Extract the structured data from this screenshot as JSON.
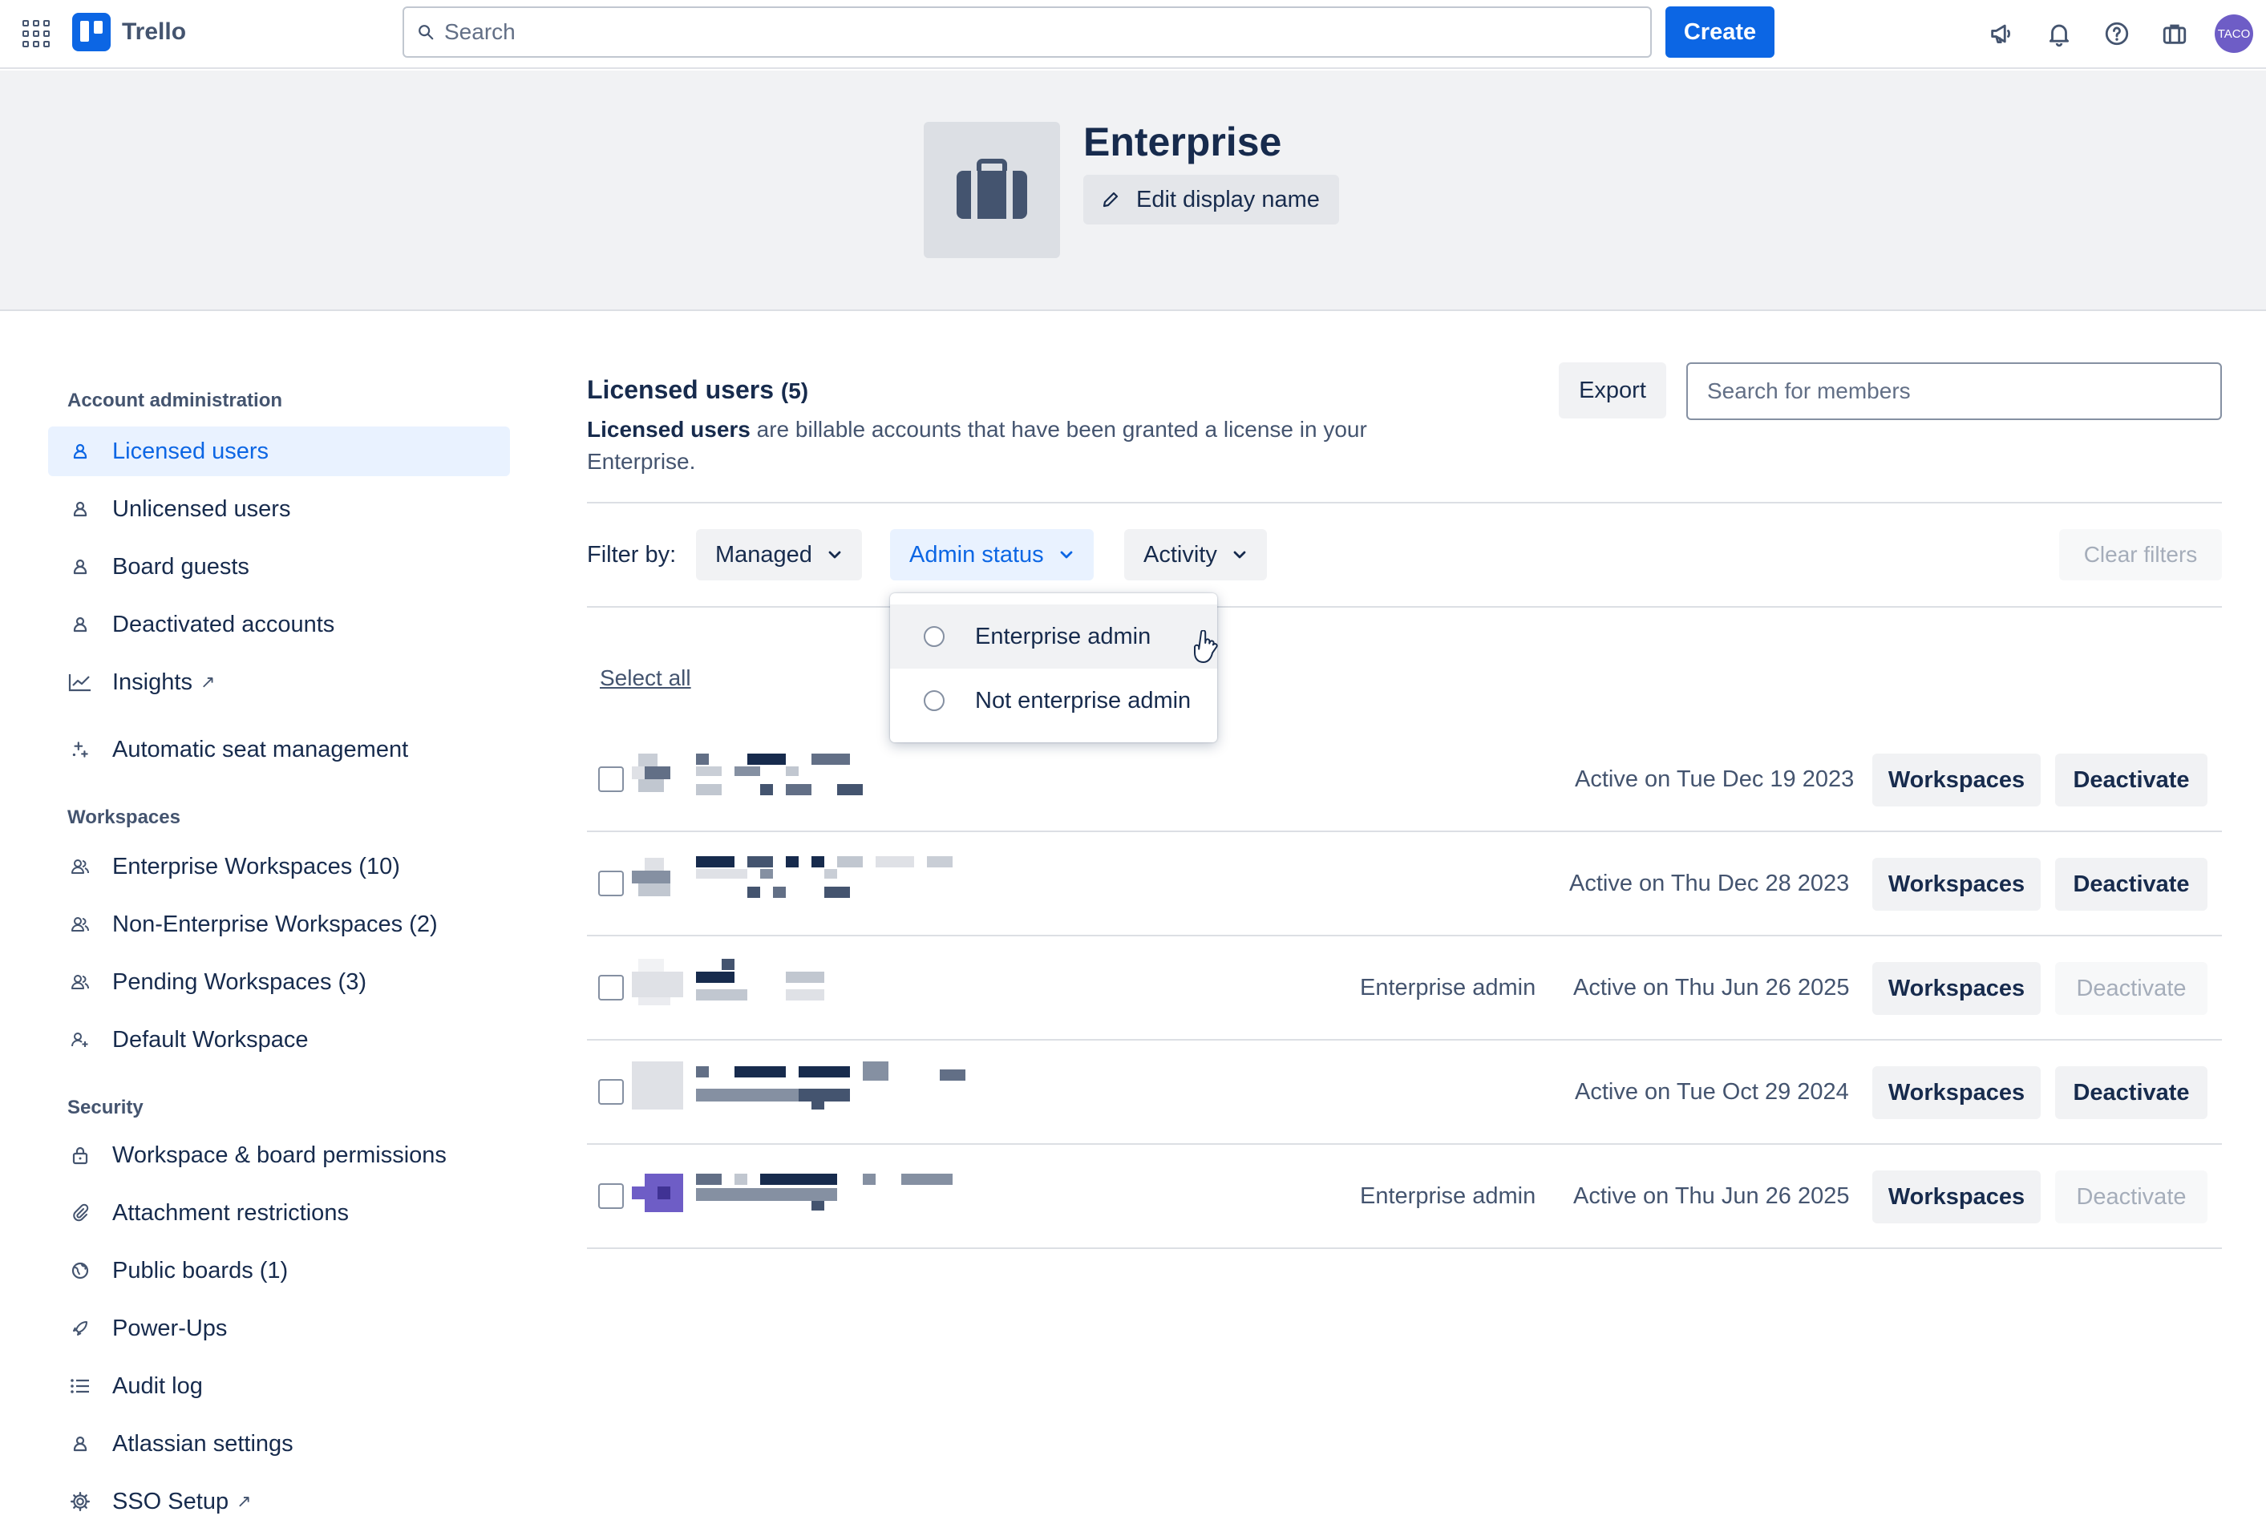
{
  "topbar": {
    "app_name": "Trello",
    "search_placeholder": "Search",
    "create_label": "Create",
    "avatar_text": "TACO"
  },
  "enterprise": {
    "name": "Enterprise",
    "edit_label": "Edit display name"
  },
  "sidebar": {
    "sections": [
      {
        "heading": "Account administration",
        "items": [
          {
            "label": "Licensed users",
            "icon": "person-icon",
            "active": true
          },
          {
            "label": "Unlicensed users",
            "icon": "person-icon"
          },
          {
            "label": "Board guests",
            "icon": "person-icon"
          },
          {
            "label": "Deactivated accounts",
            "icon": "person-icon"
          },
          {
            "label": "Insights",
            "icon": "chart-line-icon",
            "external": true
          },
          {
            "label": "Automatic seat management",
            "icon": "sparkle-icon"
          }
        ]
      },
      {
        "heading": "Workspaces",
        "items": [
          {
            "label": "Enterprise Workspaces (10)",
            "icon": "people-icon"
          },
          {
            "label": "Non-Enterprise Workspaces (2)",
            "icon": "people-icon"
          },
          {
            "label": "Pending Workspaces (3)",
            "icon": "people-icon"
          },
          {
            "label": "Default Workspace",
            "icon": "person-add-icon"
          }
        ]
      },
      {
        "heading": "Security",
        "items": [
          {
            "label": "Workspace & board permissions",
            "icon": "lock-icon"
          },
          {
            "label": "Attachment restrictions",
            "icon": "paperclip-icon"
          },
          {
            "label": "Public boards (1)",
            "icon": "globe-icon"
          },
          {
            "label": "Power-Ups",
            "icon": "rocket-icon"
          },
          {
            "label": "Audit log",
            "icon": "list-icon"
          },
          {
            "label": "Atlassian settings",
            "icon": "person-icon"
          },
          {
            "label": "SSO Setup",
            "icon": "gear-icon",
            "external": true
          }
        ]
      }
    ]
  },
  "main": {
    "title": "Licensed users",
    "count": "(5)",
    "desc_bold": "Licensed users",
    "desc_rest": " are billable accounts that have been granted a license in your Enterprise.",
    "export_label": "Export",
    "member_search_placeholder": "Search for members",
    "filter_label": "Filter by:",
    "filters": [
      "Managed",
      "Admin status",
      "Activity"
    ],
    "clear_filters": "Clear filters",
    "select_all": "Select all"
  },
  "dropdown": {
    "options": [
      "Enterprise admin",
      "Not enterprise admin"
    ]
  },
  "users": [
    {
      "admin": "",
      "active": "Active on Tue Dec 19 2023",
      "workspaces": "Workspaces",
      "deactivate": "Deactivate",
      "deactivate_disabled": false
    },
    {
      "admin": "",
      "active": "Active on Thu Dec 28 2023",
      "workspaces": "Workspaces",
      "deactivate": "Deactivate",
      "deactivate_disabled": false
    },
    {
      "admin": "Enterprise admin",
      "active": "Active on Thu Jun 26 2025",
      "workspaces": "Workspaces",
      "deactivate": "Deactivate",
      "deactivate_disabled": true
    },
    {
      "admin": "",
      "active": "Active on Tue Oct 29 2024",
      "workspaces": "Workspaces",
      "deactivate": "Deactivate",
      "deactivate_disabled": false
    },
    {
      "admin": "Enterprise admin",
      "active": "Active on Thu Jun 26 2025",
      "workspaces": "Workspaces",
      "deactivate": "Deactivate",
      "deactivate_disabled": true
    }
  ],
  "colors": {
    "brand": "#0c66e4",
    "text": "#172b4d",
    "subtle": "#44546f",
    "avatar": "#6e5dc6"
  }
}
